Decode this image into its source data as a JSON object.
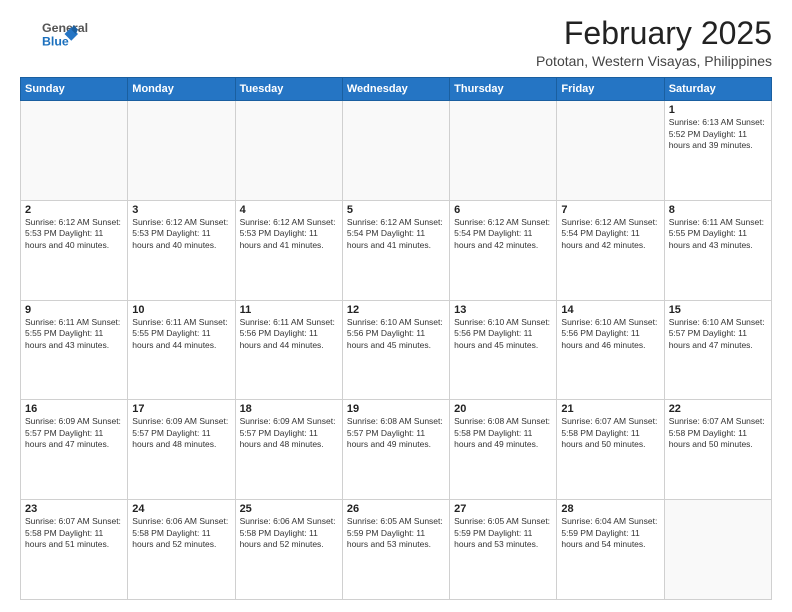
{
  "header": {
    "logo_general": "General",
    "logo_blue": "Blue",
    "month_year": "February 2025",
    "location": "Pototan, Western Visayas, Philippines"
  },
  "days_of_week": [
    "Sunday",
    "Monday",
    "Tuesday",
    "Wednesday",
    "Thursday",
    "Friday",
    "Saturday"
  ],
  "weeks": [
    [
      {
        "day": "",
        "info": ""
      },
      {
        "day": "",
        "info": ""
      },
      {
        "day": "",
        "info": ""
      },
      {
        "day": "",
        "info": ""
      },
      {
        "day": "",
        "info": ""
      },
      {
        "day": "",
        "info": ""
      },
      {
        "day": "1",
        "info": "Sunrise: 6:13 AM\nSunset: 5:52 PM\nDaylight: 11 hours and 39 minutes."
      }
    ],
    [
      {
        "day": "2",
        "info": "Sunrise: 6:12 AM\nSunset: 5:53 PM\nDaylight: 11 hours and 40 minutes."
      },
      {
        "day": "3",
        "info": "Sunrise: 6:12 AM\nSunset: 5:53 PM\nDaylight: 11 hours and 40 minutes."
      },
      {
        "day": "4",
        "info": "Sunrise: 6:12 AM\nSunset: 5:53 PM\nDaylight: 11 hours and 41 minutes."
      },
      {
        "day": "5",
        "info": "Sunrise: 6:12 AM\nSunset: 5:54 PM\nDaylight: 11 hours and 41 minutes."
      },
      {
        "day": "6",
        "info": "Sunrise: 6:12 AM\nSunset: 5:54 PM\nDaylight: 11 hours and 42 minutes."
      },
      {
        "day": "7",
        "info": "Sunrise: 6:12 AM\nSunset: 5:54 PM\nDaylight: 11 hours and 42 minutes."
      },
      {
        "day": "8",
        "info": "Sunrise: 6:11 AM\nSunset: 5:55 PM\nDaylight: 11 hours and 43 minutes."
      }
    ],
    [
      {
        "day": "9",
        "info": "Sunrise: 6:11 AM\nSunset: 5:55 PM\nDaylight: 11 hours and 43 minutes."
      },
      {
        "day": "10",
        "info": "Sunrise: 6:11 AM\nSunset: 5:55 PM\nDaylight: 11 hours and 44 minutes."
      },
      {
        "day": "11",
        "info": "Sunrise: 6:11 AM\nSunset: 5:56 PM\nDaylight: 11 hours and 44 minutes."
      },
      {
        "day": "12",
        "info": "Sunrise: 6:10 AM\nSunset: 5:56 PM\nDaylight: 11 hours and 45 minutes."
      },
      {
        "day": "13",
        "info": "Sunrise: 6:10 AM\nSunset: 5:56 PM\nDaylight: 11 hours and 45 minutes."
      },
      {
        "day": "14",
        "info": "Sunrise: 6:10 AM\nSunset: 5:56 PM\nDaylight: 11 hours and 46 minutes."
      },
      {
        "day": "15",
        "info": "Sunrise: 6:10 AM\nSunset: 5:57 PM\nDaylight: 11 hours and 47 minutes."
      }
    ],
    [
      {
        "day": "16",
        "info": "Sunrise: 6:09 AM\nSunset: 5:57 PM\nDaylight: 11 hours and 47 minutes."
      },
      {
        "day": "17",
        "info": "Sunrise: 6:09 AM\nSunset: 5:57 PM\nDaylight: 11 hours and 48 minutes."
      },
      {
        "day": "18",
        "info": "Sunrise: 6:09 AM\nSunset: 5:57 PM\nDaylight: 11 hours and 48 minutes."
      },
      {
        "day": "19",
        "info": "Sunrise: 6:08 AM\nSunset: 5:57 PM\nDaylight: 11 hours and 49 minutes."
      },
      {
        "day": "20",
        "info": "Sunrise: 6:08 AM\nSunset: 5:58 PM\nDaylight: 11 hours and 49 minutes."
      },
      {
        "day": "21",
        "info": "Sunrise: 6:07 AM\nSunset: 5:58 PM\nDaylight: 11 hours and 50 minutes."
      },
      {
        "day": "22",
        "info": "Sunrise: 6:07 AM\nSunset: 5:58 PM\nDaylight: 11 hours and 50 minutes."
      }
    ],
    [
      {
        "day": "23",
        "info": "Sunrise: 6:07 AM\nSunset: 5:58 PM\nDaylight: 11 hours and 51 minutes."
      },
      {
        "day": "24",
        "info": "Sunrise: 6:06 AM\nSunset: 5:58 PM\nDaylight: 11 hours and 52 minutes."
      },
      {
        "day": "25",
        "info": "Sunrise: 6:06 AM\nSunset: 5:58 PM\nDaylight: 11 hours and 52 minutes."
      },
      {
        "day": "26",
        "info": "Sunrise: 6:05 AM\nSunset: 5:59 PM\nDaylight: 11 hours and 53 minutes."
      },
      {
        "day": "27",
        "info": "Sunrise: 6:05 AM\nSunset: 5:59 PM\nDaylight: 11 hours and 53 minutes."
      },
      {
        "day": "28",
        "info": "Sunrise: 6:04 AM\nSunset: 5:59 PM\nDaylight: 11 hours and 54 minutes."
      },
      {
        "day": "",
        "info": ""
      }
    ]
  ]
}
